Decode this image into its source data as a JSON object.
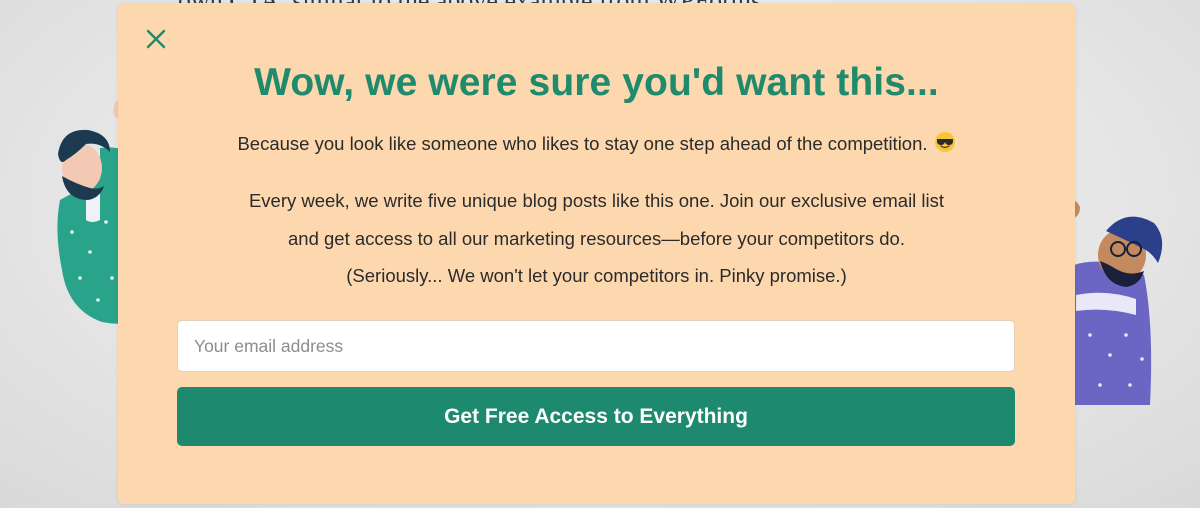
{
  "background": {
    "partial_text": "own CTA, similar to the above example from WPForms."
  },
  "modal": {
    "close_icon": "close-x-icon",
    "title": "Wow, we were sure you'd want this...",
    "subtitle": "Because you look like someone who likes to stay one step ahead of the competition.",
    "subtitle_emoji": "sunglasses-emoji",
    "body_lines": [
      "Every week, we write five unique blog posts like this one. Join our exclusive email list",
      "and get access to all our marketing resources—before your competitors do.",
      "(Seriously... We won't let your competitors in. Pinky promise.)"
    ],
    "email_placeholder": "Your email address",
    "email_value": "",
    "cta_label": "Get Free Access to Everything"
  },
  "colors": {
    "modal_bg": "#fdd8ae",
    "accent_green": "#1d8a6f",
    "title_green": "#1f8a6c",
    "person_left_shirt": "#2aa38b",
    "person_right_shirt": "#6b66c4"
  }
}
